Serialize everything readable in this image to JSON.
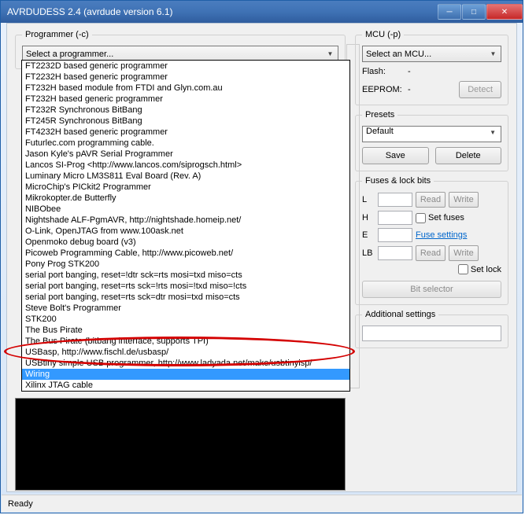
{
  "window": {
    "title": "AVRDUDESS 2.4 (avrdude version 6.1)"
  },
  "programmer": {
    "legend": "Programmer (-c)",
    "selected": "Select a programmer...",
    "highlighted_index": 28,
    "options": [
      "FT2232D based generic programmer",
      "FT2232H based generic programmer",
      "FT232H based module from FTDI and Glyn.com.au",
      "FT232H based generic programmer",
      "FT232R Synchronous BitBang",
      "FT245R Synchronous BitBang",
      "FT4232H based generic programmer",
      "Futurlec.com programming cable.",
      "Jason Kyle's pAVR Serial Programmer",
      "Lancos SI-Prog <http://www.lancos.com/siprogsch.html>",
      "Luminary Micro LM3S811 Eval Board (Rev. A)",
      "MicroChip's PICkit2 Programmer",
      "Mikrokopter.de Butterfly",
      "NIBObee",
      "Nightshade ALF-PgmAVR, http://nightshade.homeip.net/",
      "O-Link, OpenJTAG from www.100ask.net",
      "Openmoko debug board (v3)",
      "Picoweb Programming Cable, http://www.picoweb.net/",
      "Pony Prog STK200",
      "serial port banging, reset=!dtr sck=rts mosi=txd miso=cts",
      "serial port banging, reset=rts sck=!rts mosi=!txd miso=!cts",
      "serial port banging, reset=rts sck=dtr mosi=txd miso=cts",
      "Steve Bolt's Programmer",
      "STK200",
      "The Bus Pirate",
      "The Bus Pirate (bitbang interface, supports TPI)",
      "USBasp, http://www.fischl.de/usbasp/",
      "USBtiny simple USB programmer, http://www.ladyada.net/make/usbtinyisp/",
      "Wiring",
      "Xilinx JTAG cable"
    ]
  },
  "mcu": {
    "legend": "MCU (-p)",
    "selected": "Select an MCU...",
    "flash_label": "Flash:",
    "flash_value": "-",
    "eeprom_label": "EEPROM:",
    "eeprom_value": "-",
    "detect_label": "Detect"
  },
  "presets": {
    "legend": "Presets",
    "selected": "Default",
    "save_label": "Save",
    "delete_label": "Delete"
  },
  "fuses": {
    "legend": "Fuses & lock bits",
    "L": "L",
    "H": "H",
    "E": "E",
    "LB": "LB",
    "read_label": "Read",
    "write_label": "Write",
    "set_fuses_label": "Set fuses",
    "fuse_settings_label": "Fuse settings",
    "set_lock_label": "Set lock",
    "bit_selector_label": "Bit selector"
  },
  "additional": {
    "legend": "Additional settings"
  },
  "status": {
    "text": "Ready"
  }
}
